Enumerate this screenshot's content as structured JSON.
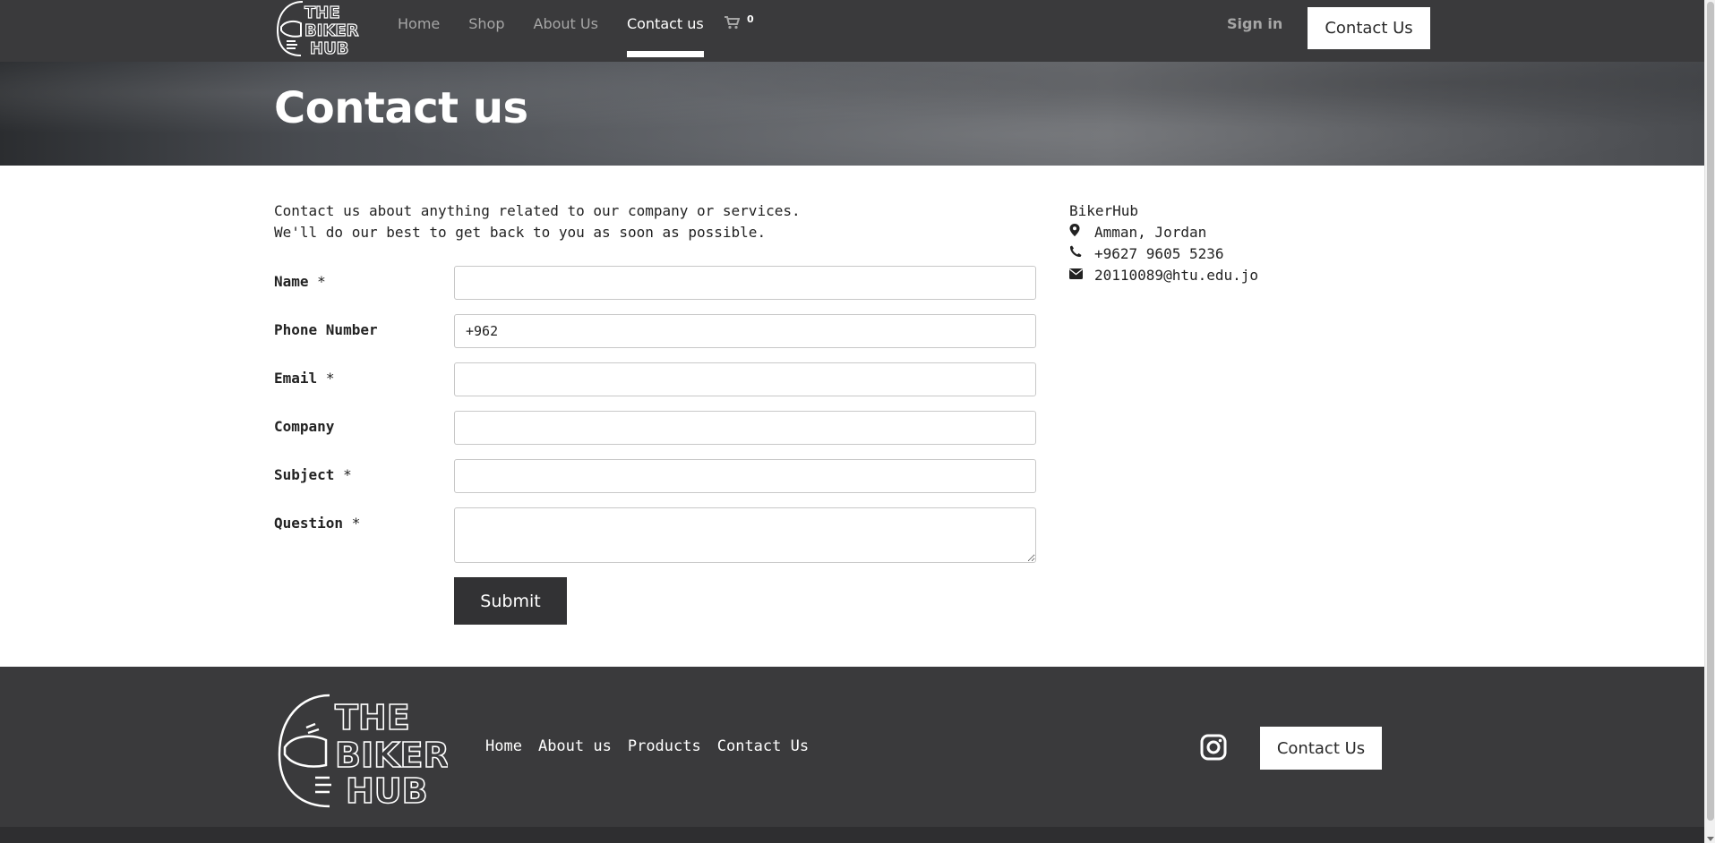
{
  "header": {
    "logo_lines": [
      "THE",
      "BIKER",
      "HUB"
    ],
    "nav": [
      {
        "label": "Home"
      },
      {
        "label": "Shop"
      },
      {
        "label": "About Us"
      },
      {
        "label": "Contact us",
        "active": true
      }
    ],
    "cart_icon": "cart-icon",
    "cart_count": "0",
    "signin_label": "Sign in",
    "contact_button": "Contact Us"
  },
  "banner": {
    "title": "Contact us"
  },
  "intro": {
    "line1": "Contact us about anything related to our company or services.",
    "line2": "We'll do our best to get back to you as soon as possible."
  },
  "form": {
    "fields": [
      {
        "label": "Name",
        "required": "*",
        "value": ""
      },
      {
        "label": "Phone Number",
        "required": "",
        "value": "+962"
      },
      {
        "label": "Email",
        "required": "*",
        "value": ""
      },
      {
        "label": "Company",
        "required": "",
        "value": ""
      },
      {
        "label": "Subject",
        "required": "*",
        "value": ""
      },
      {
        "label": "Question",
        "required": "*",
        "value": ""
      }
    ],
    "submit_label": "Submit"
  },
  "contact_info": {
    "company": "BikerHub",
    "address": "Amman, Jordan",
    "phone": "+9627 9605 5236",
    "email": "20110089@htu.edu.jo",
    "icons": [
      "map-marker-icon",
      "phone-icon",
      "envelope-icon"
    ]
  },
  "footer": {
    "nav": [
      "Home",
      "About us",
      "Products",
      "Contact Us"
    ],
    "social_icon": "instagram-icon",
    "contact_button": "Contact Us"
  },
  "colors": {
    "header_bg": "#3a3a3c",
    "footer_bg": "#3a3a3c",
    "submit_bg": "#323234",
    "nav_inactive": "#a6a6a6"
  }
}
